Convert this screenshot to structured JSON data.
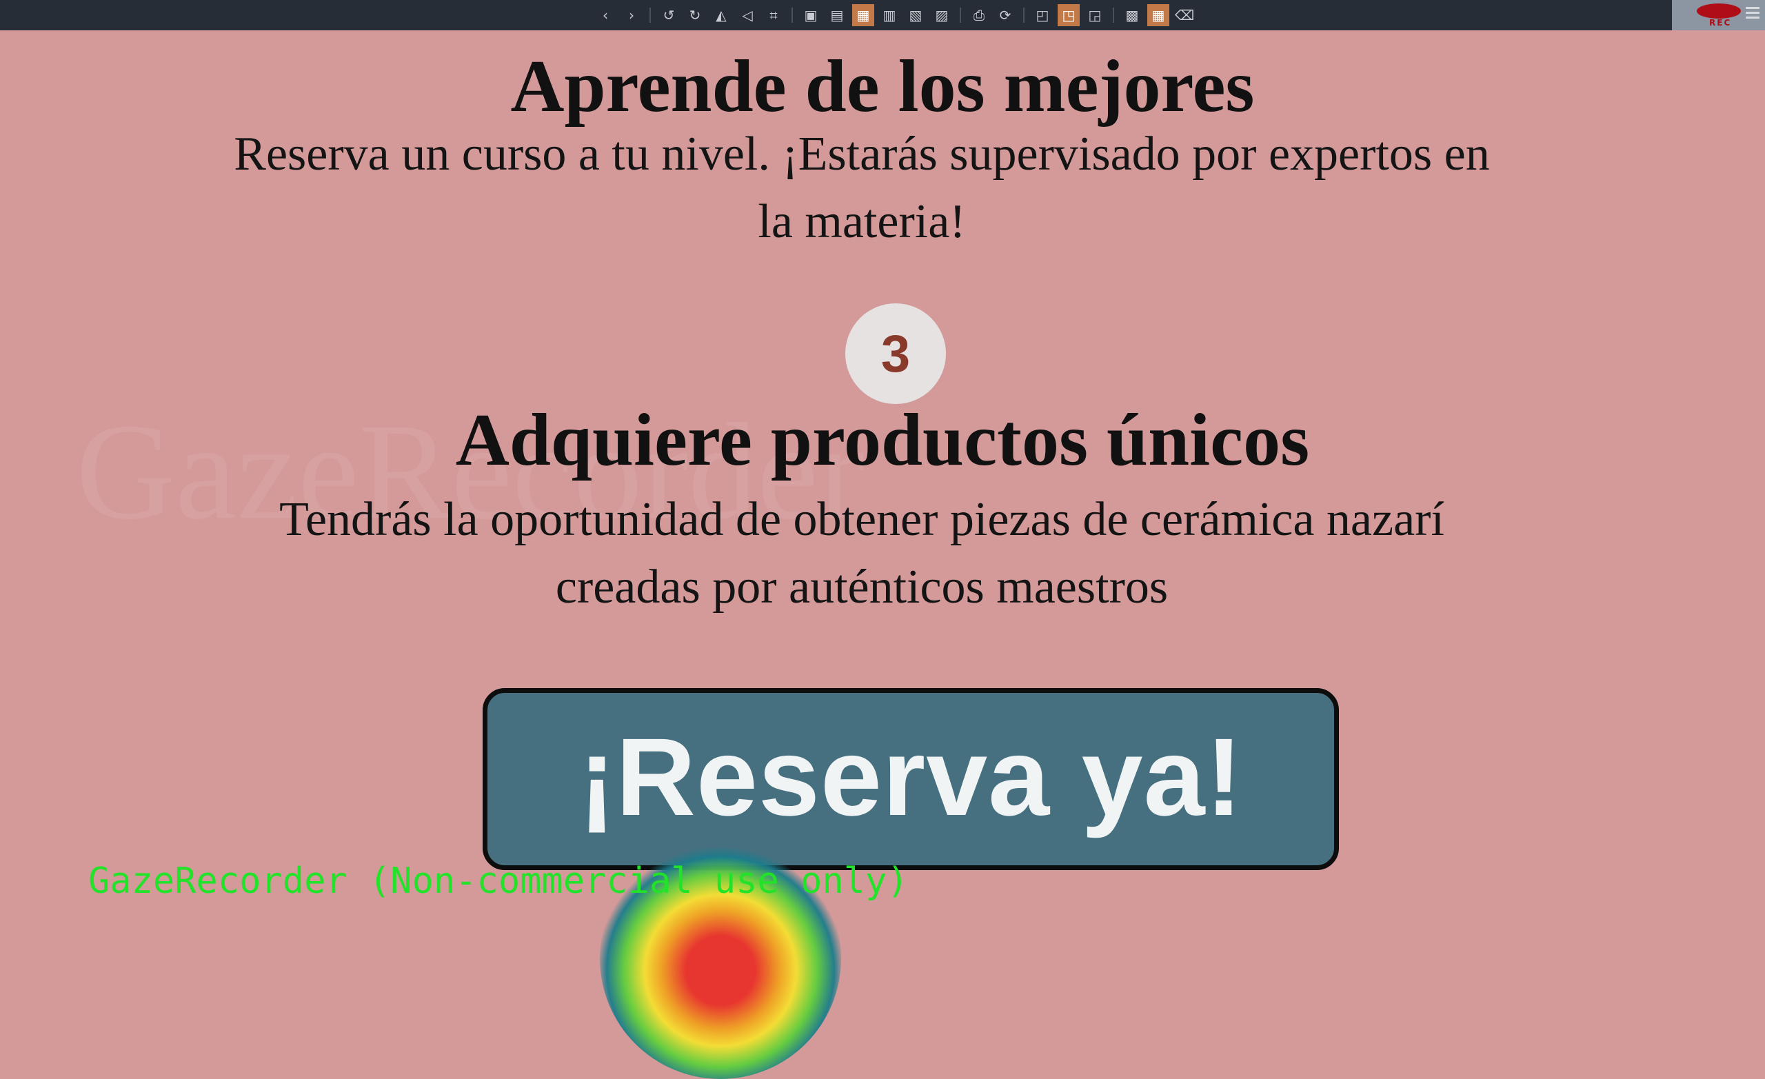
{
  "toolbar": {
    "icons": [
      "chevron-left-icon",
      "chevron-right-icon",
      "rotate-left-icon",
      "rotate-right-icon",
      "flip-horizontal-icon",
      "flip-vertical-icon",
      "crop-icon",
      "fullscreen-icon",
      "lock-icon",
      "fit-icon",
      "fit-width-icon",
      "fit-height-icon",
      "actual-size-icon",
      "print-icon",
      "refresh-icon",
      "zoom-region-icon",
      "zoom-toggle-icon",
      "annotate-icon",
      "image-icon",
      "grid-icon",
      "trash-icon"
    ],
    "rec_label": "REC",
    "accent": "#c27a49"
  },
  "watermark": "GazeRecorder",
  "section_learn": {
    "title": "Aprende de los mejores",
    "text": "Reserva un curso a tu nivel. ¡Estarás supervisado por expertos en la materia!"
  },
  "step": {
    "number": "3"
  },
  "section_products": {
    "title": "Adquiere productos únicos",
    "text": "Tendrás la oportunidad de obtener piezas de cerámica nazarí creadas por auténticos maestros"
  },
  "cta": {
    "label": "¡Reserva ya!",
    "color": "#46707f"
  },
  "gaze_overlay": {
    "note": "GazeRecorder (Non-commercial use only)"
  },
  "colors": {
    "background": "#d49a99",
    "step_number": "#8a3a2b"
  }
}
